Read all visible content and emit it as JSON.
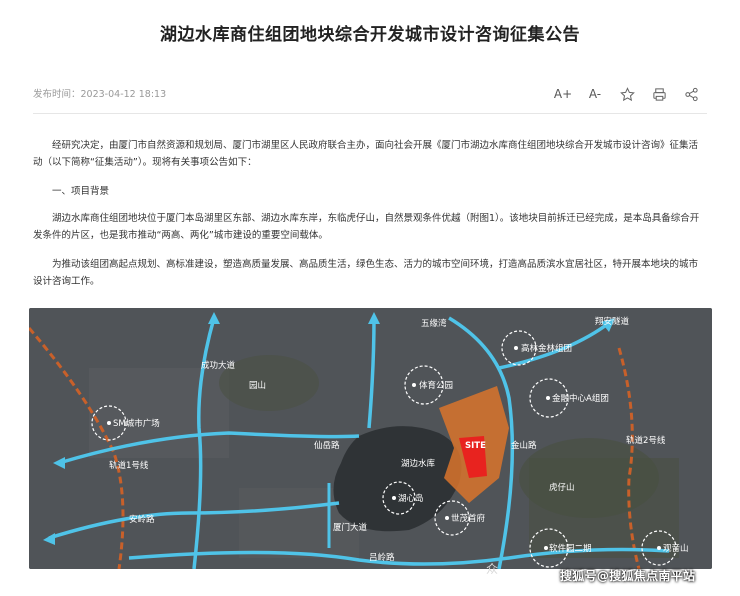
{
  "article": {
    "title": "湖边水库商住组团地块综合开发城市设计咨询征集公告",
    "publish_time": "发布时间：2023-04-12 18:13",
    "toolbar": {
      "font_increase": "A+",
      "font_decrease": "A-"
    },
    "paragraphs": {
      "intro": "经研究决定，由厦门市自然资源和规划局、厦门市湖里区人民政府联合主办，面向社会开展《厦门市湖边水库商住组团地块综合开发城市设计咨询》征集活动（以下简称“征集活动”）。现将有关事项公告如下：",
      "section1_heading": "一、项目背景",
      "background": "湖边水库商住组团地块位于厦门本岛湖里区东部、湖边水库东岸，东临虎仔山，自然景观条件优越（附图1）。该地块目前拆迁已经完成，是本岛具备综合开发条件的片区，也是我市推动“两高、两化”城市建设的重要空间载体。",
      "purpose": "为推动该组团高起点规划、高标准建设，塑造高质量发展、高品质生活，绿色生态、活力的城市空间环境，打造高品质滨水宜居社区，特开展本地块的城市设计咨询工作。"
    }
  },
  "map": {
    "site_label": "SITE",
    "places": {
      "wuyuan_bay": "五缘湾",
      "gaolin": "高林金林组团",
      "sports_park": "体育公园",
      "finance_center": "金融中心A组团",
      "sm_plaza": "SM城市广场",
      "hubian_reservoir": "湖边水库",
      "huxin_island": "湖心岛",
      "shimao": "世茂首府",
      "software_park": "软件园二期",
      "guanyin_mountain": "观音山",
      "hu_zai_shan": "虎仔山",
      "yuan_shan": "园山"
    },
    "roads": {
      "xiangan_tunnel": "翔安隧道",
      "metro_line2": "轨道2号线",
      "metro_line1": "轨道1号线",
      "chenghui_road": "仙岳路",
      "anling_road": "安岭路",
      "lvling_road": "吕岭路",
      "jinshan_road": "金山路",
      "chenggong_avenue": "成功大道",
      "xiamen_avenue": "厦门大道"
    },
    "colors": {
      "site_area": "#d9742c",
      "site_core": "#e8231f",
      "road_line": "#4fc3e8",
      "metro_line": "#c8602a"
    }
  },
  "watermark": {
    "text": "搜狐号@搜狐焦点南平站",
    "faint": "众"
  }
}
